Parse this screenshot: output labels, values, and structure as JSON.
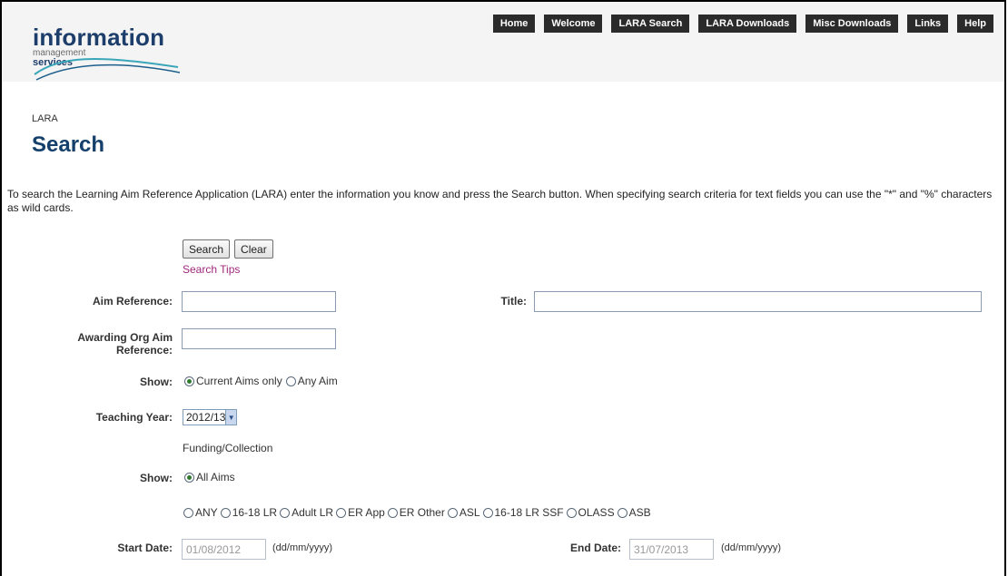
{
  "logo": {
    "word": "information",
    "sub1": "management",
    "sub2": "services"
  },
  "nav": [
    "Home",
    "Welcome",
    "LARA Search",
    "LARA Downloads",
    "Misc Downloads",
    "Links",
    "Help"
  ],
  "breadcrumb": "LARA",
  "page_title": "Search",
  "intro": "To search the Learning Aim Reference Application (LARA) enter the information you know and press the Search button. When specifying search criteria for text fields you can use the \"*\" and \"%\" characters as wild cards.",
  "buttons": {
    "search": "Search",
    "clear": "Clear"
  },
  "search_tips": "Search Tips",
  "form": {
    "aim_reference_label": "Aim Reference:",
    "aim_reference_value": "",
    "title_label": "Title:",
    "title_value": "",
    "awarding_org_label_1": "Awarding Org Aim",
    "awarding_org_label_2": "Reference:",
    "awarding_org_value": "",
    "show_label": "Show:",
    "show_options": [
      {
        "label": "Current Aims only",
        "selected": true
      },
      {
        "label": "Any Aim",
        "selected": false
      }
    ],
    "teaching_year_label": "Teaching Year:",
    "teaching_year_value": "2012/13",
    "funding_heading": "Funding/Collection",
    "show2_label": "Show:",
    "all_aims_label": "All Aims",
    "all_aims_selected": true,
    "funding_options": [
      "ANY",
      "16-18 LR",
      "Adult LR",
      "ER App",
      "ER Other",
      "ASL",
      "16-18 LR SSF",
      "OLASS",
      "ASB"
    ],
    "start_date_label": "Start Date:",
    "start_date_value": "01/08/2012",
    "end_date_label": "End Date:",
    "end_date_value": "31/07/2013",
    "date_format": "(dd/mm/yyyy)"
  }
}
